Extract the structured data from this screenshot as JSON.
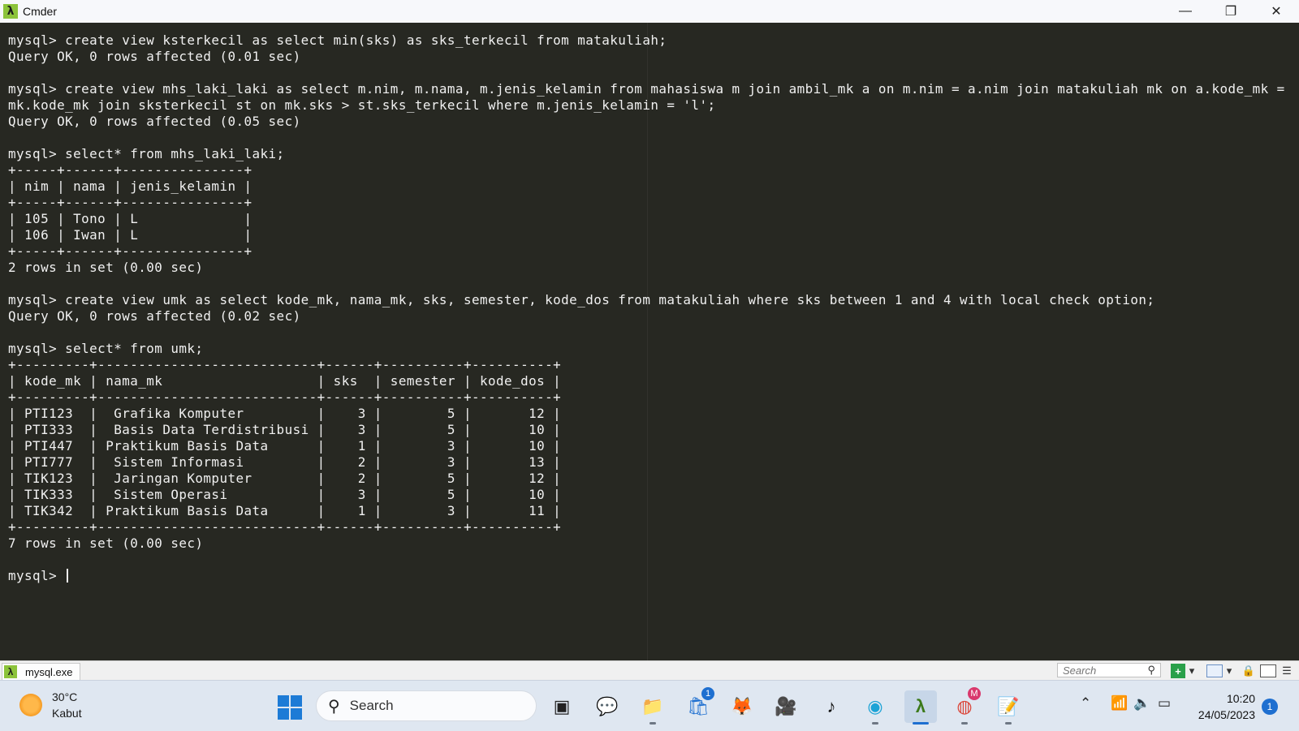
{
  "window": {
    "title": "Cmder",
    "minimize_glyph": "—",
    "maximize_glyph": "❐",
    "close_glyph": "✕"
  },
  "terminal": {
    "lines": [
      "mysql> create view ksterkecil as select min(sks) as sks_terkecil from matakuliah;",
      "Query OK, 0 rows affected (0.01 sec)",
      "",
      "mysql> create view mhs_laki_laki as select m.nim, m.nama, m.jenis_kelamin from mahasiswa m join ambil_mk a on m.nim = a.nim join matakuliah mk on a.kode_mk =",
      "mk.kode_mk join sksterkecil st on mk.sks > st.sks_terkecil where m.jenis_kelamin = 'l';",
      "Query OK, 0 rows affected (0.05 sec)",
      "",
      "mysql> select* from mhs_laki_laki;",
      "+-----+------+---------------+",
      "| nim | nama | jenis_kelamin |",
      "+-----+------+---------------+",
      "| 105 | Tono | L             |",
      "| 106 | Iwan | L             |",
      "+-----+------+---------------+",
      "2 rows in set (0.00 sec)",
      "",
      "mysql> create view umk as select kode_mk, nama_mk, sks, semester, kode_dos from matakuliah where sks between 1 and 4 with local check option;",
      "Query OK, 0 rows affected (0.02 sec)",
      "",
      "mysql> select* from umk;",
      "+---------+---------------------------+------+----------+----------+",
      "| kode_mk | nama_mk                   | sks  | semester | kode_dos |",
      "+---------+---------------------------+------+----------+----------+",
      "| PTI123  |  Grafika Komputer         |    3 |        5 |       12 |",
      "| PTI333  |  Basis Data Terdistribusi |    3 |        5 |       10 |",
      "| PTI447  | Praktikum Basis Data      |    1 |        3 |       10 |",
      "| PTI777  |  Sistem Informasi         |    2 |        3 |       13 |",
      "| TIK123  |  Jaringan Komputer        |    2 |        5 |       12 |",
      "| TIK333  |  Sistem Operasi           |    3 |        5 |       10 |",
      "| TIK342  | Praktikum Basis Data      |    1 |        3 |       11 |",
      "+---------+---------------------------+------+----------+----------+",
      "7 rows in set (0.00 sec)",
      ""
    ],
    "prompt": "mysql> "
  },
  "statusbar": {
    "tab_label": "mysql.exe",
    "search_placeholder": "Search"
  },
  "taskbar": {
    "weather_temp": "30°C",
    "weather_desc": "Kabut",
    "search_label": "Search",
    "time": "10:20",
    "date": "24/05/2023",
    "store_badge": "1",
    "chrome_badge": "M",
    "notification_count": "1"
  },
  "colors": {
    "terminal_bg": "#272822",
    "terminal_fg": "#f0f0f0",
    "cmder_green": "#8cc33a",
    "taskbar_bg": "#dfe7f1",
    "accent": "#1e6fd0"
  }
}
